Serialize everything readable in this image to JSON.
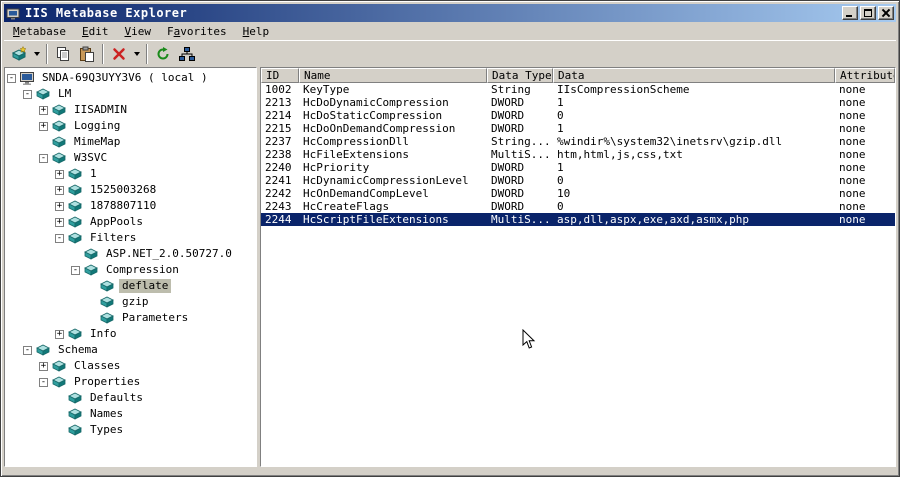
{
  "window": {
    "title": "IIS Metabase Explorer",
    "controls": [
      "minimize",
      "maximize",
      "close"
    ]
  },
  "menu": {
    "items": [
      {
        "label": "Metabase",
        "accel": 0
      },
      {
        "label": "Edit",
        "accel": 0
      },
      {
        "label": "View",
        "accel": 0
      },
      {
        "label": "Favorites",
        "accel": 1
      },
      {
        "label": "Help",
        "accel": 0
      }
    ]
  },
  "toolbar": {
    "items": [
      {
        "name": "new-item-button",
        "icon": "new-key-icon",
        "dropdown": true
      },
      {
        "separator": true
      },
      {
        "name": "copy-button",
        "icon": "copy-icon"
      },
      {
        "name": "paste-button",
        "icon": "paste-icon"
      },
      {
        "separator": true
      },
      {
        "name": "delete-button",
        "icon": "delete-icon",
        "dropdown": true
      },
      {
        "separator": true
      },
      {
        "name": "refresh-button",
        "icon": "refresh-icon"
      },
      {
        "name": "connect-button",
        "icon": "network-icon"
      }
    ]
  },
  "tree": {
    "items": [
      {
        "label": "SNDA-69Q3UYY3V6 ( local )",
        "level": 0,
        "expand": "minus",
        "icon": "computer-icon"
      },
      {
        "label": "LM",
        "level": 1,
        "expand": "minus",
        "icon": "node-icon"
      },
      {
        "label": "IISADMIN",
        "level": 2,
        "expand": "plus",
        "icon": "node-icon"
      },
      {
        "label": "Logging",
        "level": 2,
        "expand": "plus",
        "icon": "node-icon"
      },
      {
        "label": "MimeMap",
        "level": 2,
        "expand": "none",
        "icon": "node-icon"
      },
      {
        "label": "W3SVC",
        "level": 2,
        "expand": "minus",
        "icon": "node-icon"
      },
      {
        "label": "1",
        "level": 3,
        "expand": "plus",
        "icon": "node-icon"
      },
      {
        "label": "1525003268",
        "level": 3,
        "expand": "plus",
        "icon": "node-icon"
      },
      {
        "label": "1878807110",
        "level": 3,
        "expand": "plus",
        "icon": "node-icon"
      },
      {
        "label": "AppPools",
        "level": 3,
        "expand": "plus",
        "icon": "node-icon"
      },
      {
        "label": "Filters",
        "level": 3,
        "expand": "minus",
        "icon": "node-icon"
      },
      {
        "label": "ASP.NET_2.0.50727.0",
        "level": 4,
        "expand": "none",
        "icon": "node-icon"
      },
      {
        "label": "Compression",
        "level": 4,
        "expand": "minus",
        "icon": "node-icon"
      },
      {
        "label": "deflate",
        "level": 5,
        "expand": "none",
        "icon": "node-icon",
        "selected": true
      },
      {
        "label": "gzip",
        "level": 5,
        "expand": "none",
        "icon": "node-icon"
      },
      {
        "label": "Parameters",
        "level": 5,
        "expand": "none",
        "icon": "node-icon"
      },
      {
        "label": "Info",
        "level": 3,
        "expand": "plus",
        "icon": "node-icon"
      },
      {
        "label": "Schema",
        "level": 1,
        "expand": "minus",
        "icon": "node-icon"
      },
      {
        "label": "Classes",
        "level": 2,
        "expand": "plus",
        "icon": "node-icon"
      },
      {
        "label": "Properties",
        "level": 2,
        "expand": "minus",
        "icon": "node-icon"
      },
      {
        "label": "Defaults",
        "level": 3,
        "expand": "none",
        "icon": "node-icon"
      },
      {
        "label": "Names",
        "level": 3,
        "expand": "none",
        "icon": "node-icon"
      },
      {
        "label": "Types",
        "level": 3,
        "expand": "none",
        "icon": "node-icon"
      }
    ]
  },
  "table": {
    "columns": [
      "ID",
      "Name",
      "Data Type",
      "Data",
      "Attributes"
    ],
    "rows": [
      [
        "1002",
        "KeyType",
        "String",
        "IIsCompressionScheme",
        "none"
      ],
      [
        "2213",
        "HcDoDynamicCompression",
        "DWORD",
        "1",
        "none"
      ],
      [
        "2214",
        "HcDoStaticCompression",
        "DWORD",
        "0",
        "none"
      ],
      [
        "2215",
        "HcDoOnDemandCompression",
        "DWORD",
        "1",
        "none"
      ],
      [
        "2237",
        "HcCompressionDll",
        "String...",
        "%windir%\\system32\\inetsrv\\gzip.dll",
        "none"
      ],
      [
        "2238",
        "HcFileExtensions",
        "MultiS...",
        "htm,html,js,css,txt",
        "none"
      ],
      [
        "2240",
        "HcPriority",
        "DWORD",
        "1",
        "none"
      ],
      [
        "2241",
        "HcDynamicCompressionLevel",
        "DWORD",
        "0",
        "none"
      ],
      [
        "2242",
        "HcOnDemandCompLevel",
        "DWORD",
        "10",
        "none"
      ],
      [
        "2243",
        "HcCreateFlags",
        "DWORD",
        "0",
        "none"
      ],
      [
        "2244",
        "HcScriptFileExtensions",
        "MultiS...",
        "asp,dll,aspx,exe,axd,asmx,php",
        "none"
      ]
    ],
    "selected_index": 10
  },
  "colors": {
    "chrome": "#d4d0c8",
    "titlebar-start": "#0a246a",
    "titlebar-end": "#a6caf0",
    "selection": "#0a246a",
    "selection-text": "#ffffff",
    "inactive-selection": "#bdbdad",
    "panel": "#ffffff"
  }
}
